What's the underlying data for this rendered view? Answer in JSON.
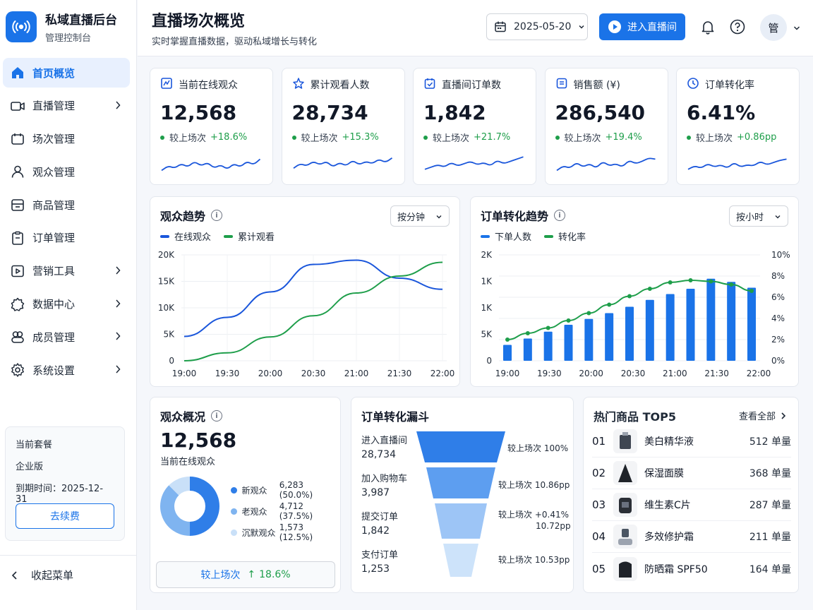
{
  "brand": {
    "title": "私域直播后台",
    "subtitle": "管理控制台"
  },
  "nav": [
    {
      "label": "首页概览",
      "icon": "home-icon",
      "active": true,
      "chevron": false
    },
    {
      "label": "直播管理",
      "icon": "video-camera-icon",
      "active": false,
      "chevron": true
    },
    {
      "label": "场次管理",
      "icon": "session-icon",
      "active": false,
      "chevron": false
    },
    {
      "label": "观众管理",
      "icon": "user-icon",
      "active": false,
      "chevron": false
    },
    {
      "label": "商品管理",
      "icon": "product-icon",
      "active": false,
      "chevron": false
    },
    {
      "label": "订单管理",
      "icon": "order-icon",
      "active": false,
      "chevron": false
    },
    {
      "label": "营销工具",
      "icon": "marketing-icon",
      "active": false,
      "chevron": true
    },
    {
      "label": "数据中心",
      "icon": "data-icon",
      "active": false,
      "chevron": true
    },
    {
      "label": "成员管理",
      "icon": "members-icon",
      "active": false,
      "chevron": true
    },
    {
      "label": "系统设置",
      "icon": "gear-icon",
      "active": false,
      "chevron": true
    }
  ],
  "plan": {
    "label": "当前套餐",
    "name": "企业版",
    "expiry": "到期时间：2025-12-31",
    "renew_label": "去续费"
  },
  "collapse_label": "收起菜单",
  "header": {
    "title": "直播场次概览",
    "subtitle": "实时掌握直播数据，驱动私域增长与转化",
    "date": "2025-05-20",
    "live_button": "进入直播间",
    "avatar": "管"
  },
  "stats": [
    {
      "title": "当前在线观众",
      "value": "12,568",
      "delta_label": "较上场次",
      "delta": "+18.6%",
      "icon": "online-icon"
    },
    {
      "title": "累计观看人数",
      "value": "28,734",
      "delta_label": "较上场次",
      "delta": "+15.3%",
      "icon": "viewers-icon"
    },
    {
      "title": "直播间订单数",
      "value": "1,842",
      "delta_label": "较上场次",
      "delta": "+21.7%",
      "icon": "orders-icon"
    },
    {
      "title": "销售额 (¥)",
      "value": "286,540",
      "delta_label": "较上场次",
      "delta": "+19.4%",
      "icon": "sales-icon"
    },
    {
      "title": "订单转化率",
      "value": "6.41%",
      "delta_label": "较上场次",
      "delta": "+0.86pp",
      "icon": "clock-icon"
    }
  ],
  "audience_trend": {
    "title": "观众趋势",
    "select": "按分钟",
    "legend": [
      "在线观众",
      "累计观看"
    ]
  },
  "conversion_trend": {
    "title": "订单转化趋势",
    "select": "按小时",
    "legend": [
      "下单人数",
      "转化率"
    ]
  },
  "chart_data": [
    {
      "type": "line",
      "title": "观众趋势",
      "x": [
        "19:00",
        "19:30",
        "20:00",
        "20:30",
        "21:00",
        "21:30",
        "22:00"
      ],
      "y_ticks": [
        "0",
        "5K",
        "10K",
        "15K",
        "20K"
      ],
      "ylim": [
        0,
        20000
      ],
      "grid": true,
      "legend": "top-left",
      "series": [
        {
          "name": "在线观众",
          "color": "#1a56db",
          "values": [
            4600,
            8200,
            13000,
            18200,
            19000,
            15600,
            13500
          ]
        },
        {
          "name": "累计观看",
          "color": "#1e9e4a",
          "values": [
            0,
            1500,
            4500,
            8500,
            12800,
            16000,
            18600
          ]
        }
      ]
    },
    {
      "type": "bar",
      "title": "订单转化趋势",
      "x": [
        "19:00",
        "19:30",
        "20:00",
        "20:30",
        "21:00",
        "21:30",
        "22:00"
      ],
      "y_ticks": [
        "0",
        "5K",
        "1K",
        "1K",
        "2K"
      ],
      "y2_ticks": [
        "0%",
        "2%",
        "4%",
        "6%",
        "8%",
        "10%"
      ],
      "ylim": [
        0,
        2000
      ],
      "y2lim": [
        0,
        10
      ],
      "grid": true,
      "legend": "top-left",
      "series": [
        {
          "name": "下单人数",
          "color": "#1a73e8",
          "type": "bar",
          "values": [
            300,
            420,
            550,
            680,
            790,
            900,
            1020,
            1150,
            1260,
            1360,
            1550,
            1490,
            1380
          ]
        },
        {
          "name": "转化率",
          "color": "#1e9e4a",
          "type": "line",
          "axis": "right",
          "values": [
            2.0,
            2.6,
            3.1,
            3.8,
            4.5,
            5.3,
            6.1,
            6.8,
            7.4,
            7.6,
            7.5,
            7.2,
            6.6
          ]
        }
      ]
    },
    {
      "type": "pie",
      "title": "观众概况",
      "series": [
        {
          "name": "新观众",
          "value": 6283,
          "label": "6,283 (50.0%)",
          "color": "#2f7ee8"
        },
        {
          "name": "老观众",
          "value": 4712,
          "label": "4,712 (37.5%)",
          "color": "#7fb4f0"
        },
        {
          "name": "沉默观众",
          "value": 1573,
          "label": "1,573 (12.5%)",
          "color": "#c9e0f8"
        }
      ]
    }
  ],
  "audience_overview": {
    "title": "观众概况",
    "value": "12,568",
    "sub": "当前在线观众",
    "compare_label": "较上场次",
    "compare_value": "18.6%"
  },
  "funnel": {
    "title": "订单转化漏斗",
    "steps": [
      {
        "name": "进入直播间",
        "value": "28,734",
        "rate": "较上场次 100%"
      },
      {
        "name": "加入购物车",
        "value": "3,987",
        "rate": "较上场次 10.86pp"
      },
      {
        "name": "提交订单",
        "value": "1,842",
        "rate": "较上场次",
        "rate2": "+0.41%",
        "rate3": "10.72pp"
      },
      {
        "name": "支付订单",
        "value": "1,253",
        "rate": "较上场次 10.53pp"
      }
    ]
  },
  "top_products": {
    "title": "热门商品 TOP5",
    "view_all": "查看全部",
    "items": [
      {
        "rank": "01",
        "name": "美白精华液",
        "count": "512 单量"
      },
      {
        "rank": "02",
        "name": "保湿面膜",
        "count": "368 单量"
      },
      {
        "rank": "03",
        "name": "维生素C片",
        "count": "287 单量"
      },
      {
        "rank": "04",
        "name": "多效修护霜",
        "count": "211 单量"
      },
      {
        "rank": "05",
        "name": "防晒霜 SPF50",
        "count": "164 单量"
      }
    ]
  }
}
